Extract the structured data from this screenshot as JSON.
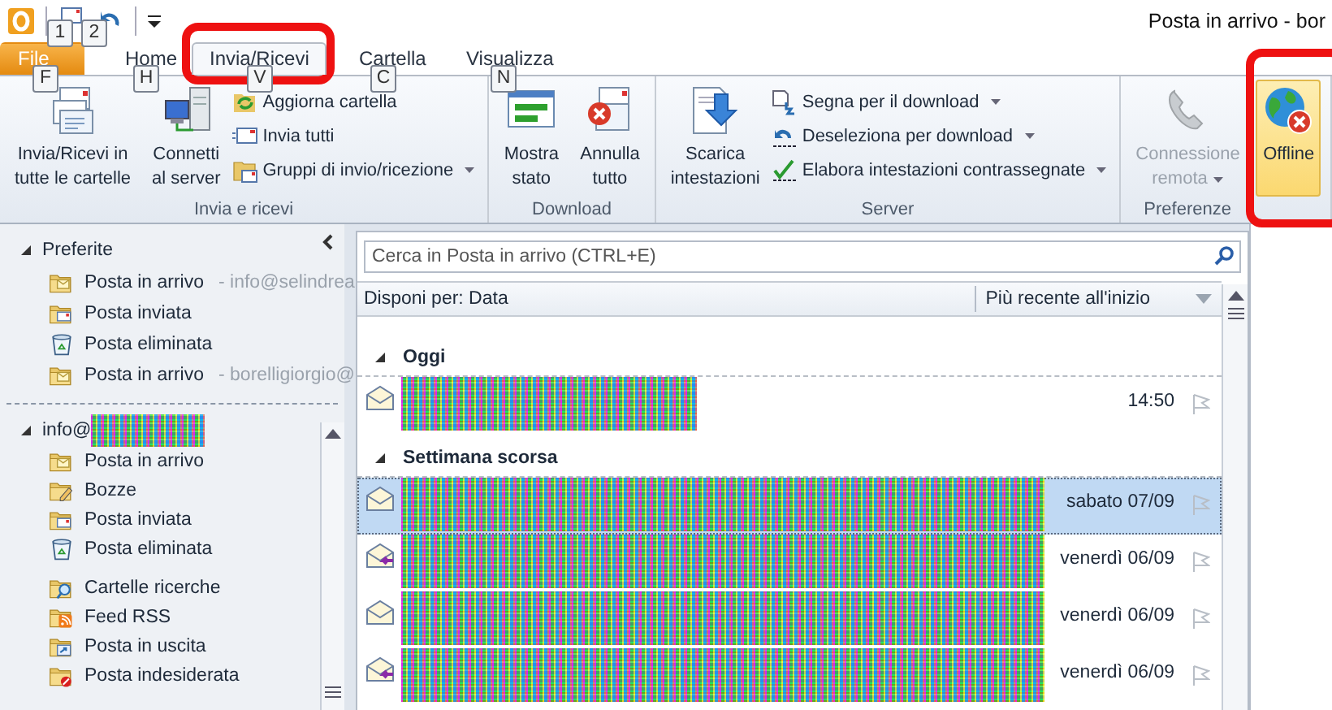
{
  "window": {
    "title": "Posta in arrivo - bor"
  },
  "quick_access": {
    "keytips": [
      "1",
      "2"
    ]
  },
  "tabs": [
    {
      "label": "File",
      "kind": "file",
      "keytip": "F",
      "selected": false
    },
    {
      "label": "Home",
      "kind": "tab",
      "keytip": "H",
      "selected": false
    },
    {
      "label": "Invia/Ricevi",
      "kind": "tab",
      "keytip": "V",
      "selected": true
    },
    {
      "label": "Cartella",
      "kind": "tab",
      "keytip": "C",
      "selected": false
    },
    {
      "label": "Visualizza",
      "kind": "tab",
      "keytip": "N",
      "selected": false
    }
  ],
  "ribbon": [
    {
      "label": "Invia e ricevi",
      "large": [
        {
          "lines": [
            "Invia/Ricevi in",
            "tutte le cartelle"
          ],
          "disabled": false,
          "selected": false,
          "dropdown": false
        },
        {
          "lines": [
            "Connetti",
            "al server"
          ],
          "disabled": false,
          "selected": false,
          "dropdown": false
        }
      ],
      "small": [
        {
          "label": "Aggiorna cartella",
          "dropdown": false
        },
        {
          "label": "Invia tutti",
          "dropdown": false
        },
        {
          "label": "Gruppi di invio/ricezione",
          "dropdown": true
        }
      ]
    },
    {
      "label": "Download",
      "large": [
        {
          "lines": [
            "Mostra",
            "stato"
          ],
          "disabled": false,
          "selected": false,
          "dropdown": false
        },
        {
          "lines": [
            "Annulla",
            "tutto"
          ],
          "disabled": false,
          "selected": false,
          "dropdown": false
        }
      ]
    },
    {
      "label": "Server",
      "large": [
        {
          "lines": [
            "Scarica",
            "intestazioni"
          ],
          "disabled": false,
          "selected": false,
          "dropdown": false
        }
      ],
      "small": [
        {
          "label": "Segna per il download",
          "dropdown": true
        },
        {
          "label": "Deseleziona per download",
          "dropdown": true
        },
        {
          "label": "Elabora intestazioni contrassegnate",
          "dropdown": true
        }
      ]
    },
    {
      "label": "Preferenze",
      "large": [
        {
          "lines": [
            "Connessione",
            "remota"
          ],
          "disabled": true,
          "selected": false,
          "dropdown": true
        },
        {
          "lines": [
            "Offline"
          ],
          "disabled": false,
          "selected": true,
          "dropdown": false
        }
      ]
    }
  ],
  "navigation": {
    "favorites": {
      "label": "Preferite",
      "expanded": true,
      "items": [
        {
          "name": "Posta in arrivo",
          "account": "- info@selindrea"
        },
        {
          "name": "Posta inviata"
        },
        {
          "name": "Posta eliminata"
        },
        {
          "name": "Posta in arrivo",
          "account": "- borelligiorgio@"
        }
      ]
    },
    "mailbox": {
      "label": "info@",
      "expanded": true,
      "items": [
        {
          "name": "Posta in arrivo"
        },
        {
          "name": "Bozze"
        },
        {
          "name": "Posta inviata"
        },
        {
          "name": "Posta eliminata"
        },
        {
          "name": "Cartelle ricerche"
        },
        {
          "name": "Feed RSS"
        },
        {
          "name": "Posta in uscita"
        },
        {
          "name": "Posta indesiderata"
        }
      ]
    }
  },
  "mail_list": {
    "search": {
      "placeholder": "Cerca in Posta in arrivo (CTRL+E)"
    },
    "arrange_by": "Disponi per: Data",
    "sort_order": "Più recente all'inizio",
    "groups": [
      {
        "label": "Oggi",
        "expanded": true,
        "messages": [
          {
            "date": "14:50",
            "replied": false,
            "selected": false
          }
        ]
      },
      {
        "label": "Settimana scorsa",
        "expanded": true,
        "messages": [
          {
            "date": "sabato 07/09",
            "replied": false,
            "selected": true
          },
          {
            "date": "venerdì 06/09",
            "replied": true,
            "selected": false
          },
          {
            "date": "venerdì 06/09",
            "replied": false,
            "selected": false
          },
          {
            "date": "venerdì 06/09",
            "replied": true,
            "selected": false
          }
        ]
      }
    ]
  }
}
